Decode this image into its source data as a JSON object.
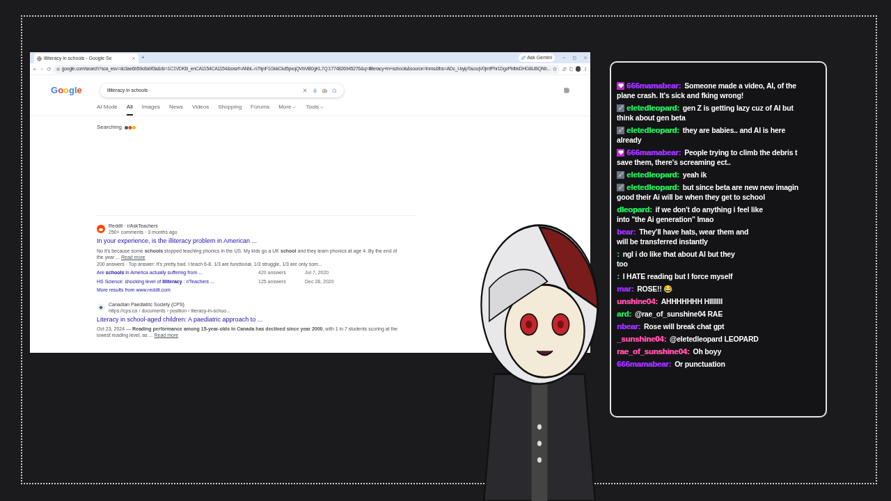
{
  "browser": {
    "tab_title": "illiteracy in schools - Google Se",
    "new_tab": "+",
    "ask_gemini": "Ask Gemini",
    "url": "google.com/search?sca_esv=dc3ae6b59c8a9f3a&rlz=1C1VDKB_enCA1154CA1154&sxsrf=ANbL-n7hjnF1GkkCkd5pxqQVbVi80gKL7Q:1774826945276&q=illiteracy+in+schools&source=lnms&fbs=ADc_l-byipTacoqV0jmfPhr1DgzPkfbkDHG8UBQNb...",
    "logo": "Google",
    "query": "illiteracy in schools",
    "nav": [
      {
        "label": "AI Mode",
        "selected": false,
        "dropdown": false
      },
      {
        "label": "All",
        "selected": true,
        "dropdown": false
      },
      {
        "label": "Images",
        "selected": false,
        "dropdown": false
      },
      {
        "label": "News",
        "selected": false,
        "dropdown": false
      },
      {
        "label": "Videos",
        "selected": false,
        "dropdown": false
      },
      {
        "label": "Shopping",
        "selected": false,
        "dropdown": false
      },
      {
        "label": "Forums",
        "selected": false,
        "dropdown": false
      },
      {
        "label": "More",
        "selected": false,
        "dropdown": true
      },
      {
        "label": "Tools",
        "selected": false,
        "dropdown": true
      }
    ],
    "status": "Searching",
    "results": [
      {
        "kind": "reddit",
        "source": "Reddit · r/AskTeachers",
        "meta": "250+ comments · 3 months ago",
        "title": "In your experience, is the illiteracy problem in American ...",
        "snippet": "No it's because some **schools** stopped teaching phonics in the US. My kids go a UK **school** and they learn phonics at age 4. By the end of the year ...",
        "read_more": "Read more",
        "answer": "200 answers · Top answer: It's pretty bad. I teach 6-8. 1/3 are functional, 1/3 struggle, 1/3 are only som...",
        "links": [
          {
            "title": "Are **schools** in America actually suffering from ...",
            "answers": "420 answers",
            "date": "Jul 7, 2020"
          },
          {
            "title": "HS Science: shocking level of **illiteracy** : r/Teachers ...",
            "answers": "125 answers",
            "date": "Dec 28, 2020"
          }
        ],
        "more": "More results from www.reddit.com"
      },
      {
        "kind": "cps",
        "source": "Canadian Paediatric Society (CPS)",
        "meta": "https://cps.ca › documents › position › literacy-in-schoo...",
        "title": "Literacy in school-aged children: A paediatric approach to ...",
        "snippet": "Oct 23, 2024 — **Reading performance among 15-year-olds in Canada has declined since year 2000**, with 1 in 7 students scoring at the lowest reading level, as ...",
        "read_more": "Read more"
      }
    ]
  },
  "chat": [
    {
      "kind": "heart",
      "user": "666mamabear:",
      "color": "#9b30ff",
      "lines": [
        "Someone made a video, AI, of the",
        "plane crash. It's sick and fking wrong!"
      ]
    },
    {
      "kind": "sword",
      "user": "eletedleopard:",
      "color": "#22e05a",
      "lines": [
        "gen Z is getting lazy cuz of AI but",
        "think about gen beta"
      ]
    },
    {
      "kind": "sword",
      "user": "eletedleopard:",
      "color": "#22e05a",
      "lines": [
        "they are babies.. and AI is here",
        "already"
      ]
    },
    {
      "kind": "heart",
      "user": "666mamabear:",
      "color": "#9b30ff",
      "lines": [
        "People trying to climb the debris t",
        "save them, there's screaming ect.."
      ]
    },
    {
      "kind": "sword",
      "user": "eletedleopard:",
      "color": "#22e05a",
      "lines": [
        "yeah ik"
      ]
    },
    {
      "kind": "sword",
      "user": "eletedleopard:",
      "color": "#22e05a",
      "lines": [
        "but since beta are new new imagin",
        "good their Ai will be when they get to school"
      ]
    },
    {
      "kind": "plain",
      "user": "dleopard:",
      "color": "#22e05a",
      "lines": [
        "if we don't do anything i feel like",
        "into \"the Ai generation\" lmao"
      ]
    },
    {
      "kind": "plain",
      "user": "bear:",
      "color": "#9b30ff",
      "lines": [
        "They'll have hats, wear them and",
        "will be transferred instantly"
      ]
    },
    {
      "kind": "plain",
      "user": ":",
      "color": "#22e05a",
      "lines": [
        "ngl i do like that about AI but they",
        "too"
      ]
    },
    {
      "kind": "plain",
      "user": ":",
      "color": "#22e05a",
      "lines": [
        "I HATE reading but I force myself"
      ]
    },
    {
      "kind": "plain",
      "user": "mar:",
      "color": "#9b30ff",
      "lines": [
        "ROSE!! 😂"
      ]
    },
    {
      "kind": "plain",
      "user": "unshine04:",
      "color": "#ff4fa8",
      "lines": [
        "AHHHHHHH HIIIIIII"
      ]
    },
    {
      "kind": "plain",
      "user": "ard:",
      "color": "#22e05a",
      "lines": [
        "@rae_of_sunshine04 RAE"
      ]
    },
    {
      "kind": "plain",
      "user": "nbear:",
      "color": "#9b30ff",
      "lines": [
        "Rose will break chat gpt"
      ]
    },
    {
      "kind": "plain",
      "user": "_sunshine04:",
      "color": "#ff4fa8",
      "lines": [
        "@eletedleopard LEOPARD"
      ]
    },
    {
      "kind": "plain",
      "user": "rae_of_sunshine04:",
      "color": "#ff4fa8",
      "lines": [
        "Oh boyy"
      ]
    },
    {
      "kind": "plain",
      "user": "666mamabear:",
      "color": "#9b30ff",
      "lines": [
        "Or punctuation"
      ]
    }
  ]
}
